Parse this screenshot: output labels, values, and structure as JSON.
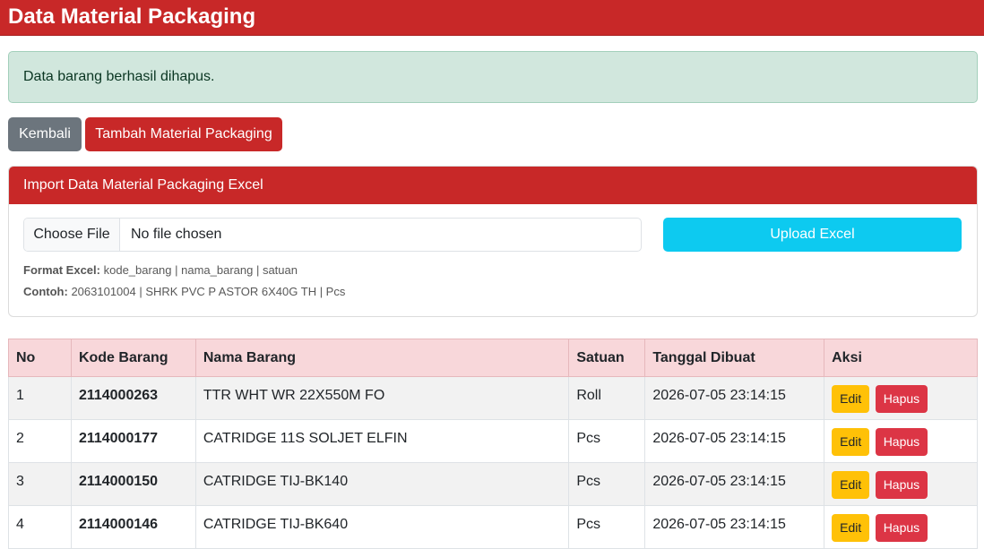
{
  "page": {
    "title": "Data Material Packaging"
  },
  "alert": {
    "message": "Data barang berhasil dihapus."
  },
  "actions": {
    "back_label": "Kembali",
    "add_label": "Tambah Material Packaging"
  },
  "import": {
    "header": "Import Data Material Packaging Excel",
    "choose_file_label": "Choose File",
    "no_file_text": "No file chosen",
    "upload_label": "Upload Excel",
    "format_label": "Format Excel:",
    "format_value": "kode_barang | nama_barang | satuan",
    "example_label": "Contoh:",
    "example_value": "2063101004 | SHRK PVC P ASTOR 6X40G TH | Pcs"
  },
  "table": {
    "columns": [
      "No",
      "Kode Barang",
      "Nama Barang",
      "Satuan",
      "Tanggal Dibuat",
      "Aksi"
    ],
    "rows": [
      {
        "no": "1",
        "kode": "2114000263",
        "nama": "TTR WHT WR 22X550M FO",
        "satuan": "Roll",
        "tanggal": "2026-07-05 23:14:15",
        "edit": "Edit",
        "hapus": "Hapus"
      },
      {
        "no": "2",
        "kode": "2114000177",
        "nama": "CATRIDGE 11S SOLJET ELFIN",
        "satuan": "Pcs",
        "tanggal": "2026-07-05 23:14:15",
        "edit": "Edit",
        "hapus": "Hapus"
      },
      {
        "no": "3",
        "kode": "2114000150",
        "nama": "CATRIDGE TIJ-BK140",
        "satuan": "Pcs",
        "tanggal": "2026-07-05 23:14:15",
        "edit": "Edit",
        "hapus": "Hapus"
      },
      {
        "no": "4",
        "kode": "2114000146",
        "nama": "CATRIDGE TIJ-BK640",
        "satuan": "Pcs",
        "tanggal": "2026-07-05 23:14:15",
        "edit": "Edit",
        "hapus": "Hapus"
      }
    ]
  },
  "colors": {
    "brand_red": "#c82828",
    "success_bg": "#d1e7dd",
    "info": "#0dcaf0",
    "warning": "#ffc107",
    "danger": "#dc3545",
    "secondary": "#6c757d",
    "table_header_bg": "#f8d7da"
  }
}
